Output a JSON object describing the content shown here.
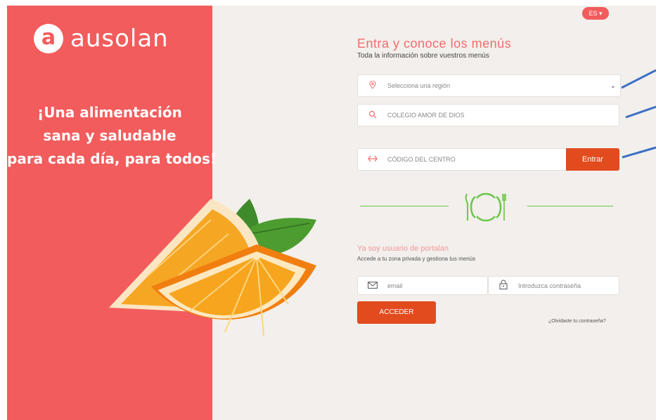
{
  "brand": {
    "logo_letter": "a",
    "name": "ausolan"
  },
  "tagline": {
    "line1": "¡Una alimentación",
    "line2": "sana y saludable",
    "line3": "para cada día, para todos!"
  },
  "language": {
    "label": "ES ▾"
  },
  "menus": {
    "title": "Entra y conoce los menús",
    "subtitle": "Toda la información sobre vuestros menús",
    "region_placeholder": "Selecciona una región",
    "school_value": "COLEGIO AMOR DE DIOS",
    "code_placeholder": "CÓDIGO DEL CENTRO",
    "enter_label": "Entrar"
  },
  "login": {
    "title": "Ya soy usuario de portalan",
    "subtitle": "Accede a tu zona privada y gestiona tus menús",
    "email_placeholder": "email",
    "password_placeholder": "Introduzca contraseña",
    "submit_label": "ACCEDER",
    "forgot_label": "¿Olvidaste tu contraseña?"
  },
  "icons": {
    "location": "map-pin-icon",
    "search": "search-icon",
    "code": "code-arrows-icon",
    "email": "envelope-icon",
    "password": "padlock-icon",
    "plate": "plate-cutlery-icon"
  },
  "colors": {
    "brand_red": "#f25c5c",
    "button_orange": "#e24b1e",
    "divider_green": "#6cc64a",
    "annotation_blue": "#3b6fc4"
  }
}
